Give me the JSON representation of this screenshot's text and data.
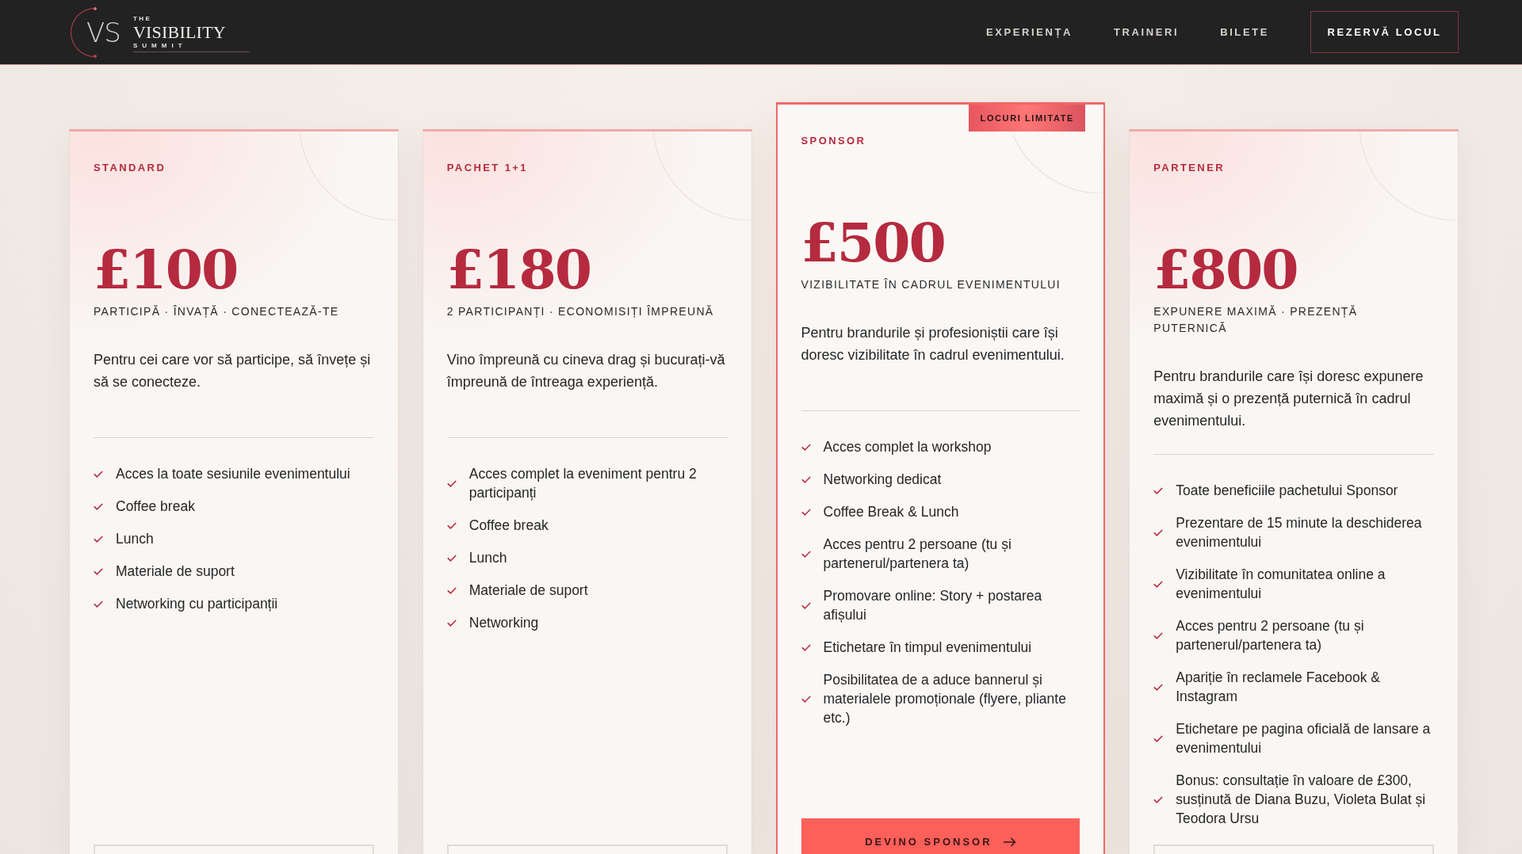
{
  "header": {
    "logo": {
      "monogram": "VS",
      "top_line": "THE",
      "name": "VISIBILITY",
      "bottom_line": "SUMMIT"
    },
    "nav": [
      {
        "label": "EXPERIENȚA"
      },
      {
        "label": "TRAINERI"
      },
      {
        "label": "BILETE"
      }
    ],
    "cta": "REZERVĂ LOCUL"
  },
  "plans": [
    {
      "featured": false,
      "label": "STANDARD",
      "price": "£100",
      "subtitle": "PARTICIPĂ · ÎNVAȚĂ · CONECTEAZĂ-TE",
      "description": "Pentru cei care vor să participe, să învețe și să se conecteze.",
      "features": [
        "Acces la toate sesiunile evenimentului",
        "Coffee break",
        "Lunch",
        "Materiale de suport",
        "Networking cu participanții"
      ],
      "button": {
        "kind": "outline"
      }
    },
    {
      "featured": false,
      "label": "PACHET 1+1",
      "price": "£180",
      "subtitle": "2 PARTICIPANȚI · ECONOMISIȚI ÎMPREUNĂ",
      "description": "Vino împreună cu cineva drag și bucurați-vă împreună de întreaga experiență.",
      "features": [
        "Acces complet la eveniment pentru 2 participanți",
        "Coffee break",
        "Lunch",
        "Materiale de suport",
        "Networking"
      ],
      "button": {
        "kind": "outline"
      }
    },
    {
      "featured": true,
      "badge": "LOCURI LIMITATE",
      "label": "SPONSOR",
      "price": "£500",
      "subtitle": "VIZIBILITATE ÎN CADRUL EVENIMENTULUI",
      "description": "Pentru brandurile și profesioniștii care își doresc vizibilitate în cadrul evenimentului.",
      "features": [
        "Acces complet la workshop",
        "Networking dedicat",
        "Coffee Break & Lunch",
        "Acces pentru 2 persoane (tu și partenerul/partenera ta)",
        "Promovare online: Story + postarea afișului",
        "Etichetare în timpul evenimentului",
        "Posibilitatea de a aduce bannerul și materialele promoționale (flyere, pliante etc.)"
      ],
      "button": {
        "kind": "filled",
        "label": "DEVINO SPONSOR"
      }
    },
    {
      "featured": false,
      "label": "PARTENER",
      "price": "£800",
      "subtitle": "EXPUNERE MAXIMĂ · PREZENȚĂ PUTERNICĂ",
      "description": "Pentru brandurile care își doresc expunere maximă și o prezență puternică în cadrul evenimentului.",
      "features": [
        "Toate beneficiile pachetului Sponsor",
        "Prezentare de 15 minute la deschiderea evenimentului",
        "Vizibilitate în comunitatea online a evenimentului",
        "Acces pentru 2 persoane (tu și partenerul/partenera ta)",
        "Apariție în reclamele Facebook & Instagram",
        "Etichetare pe pagina oficială de lansare a evenimentului",
        "Bonus: consultație în valoare de £300, susținută de Diana Buzu, Violeta Bulat și Teodora Ursu"
      ],
      "button": {
        "kind": "outline"
      }
    }
  ]
}
